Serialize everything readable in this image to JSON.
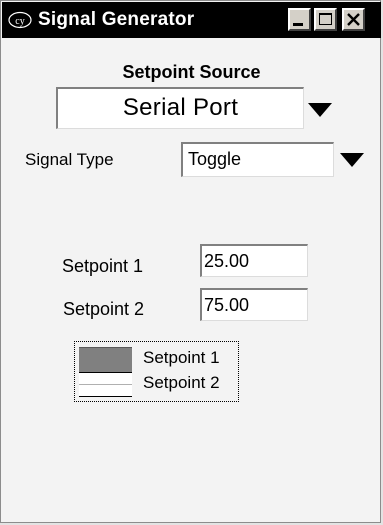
{
  "window": {
    "title": "Signal Generator",
    "app_icon": "cyclone-logo-icon",
    "controls": [
      "minimize-icon",
      "maximize-icon",
      "close-icon"
    ]
  },
  "setpoint_source": {
    "label": "Setpoint Source",
    "selected": "Serial Port"
  },
  "signal_type": {
    "label": "Signal Type",
    "selected": "Toggle"
  },
  "setpoints": [
    {
      "label": "Setpoint 1",
      "value": "25.00"
    },
    {
      "label": "Setpoint 2",
      "value": "75.00"
    }
  ],
  "legend": {
    "items": [
      {
        "label": "Setpoint 1",
        "color": "#808080"
      },
      {
        "label": "Setpoint 2",
        "color": "#ffffff"
      }
    ]
  },
  "colors": {
    "titlebar": "#000000",
    "window_background": "#f3f3f3"
  }
}
